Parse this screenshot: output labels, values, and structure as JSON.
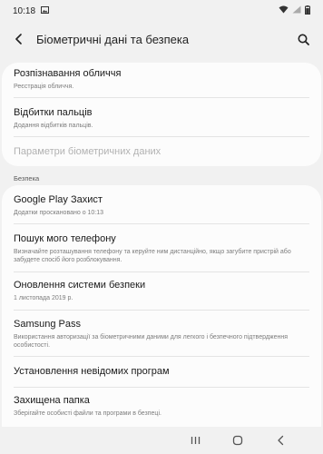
{
  "status_bar": {
    "time": "10:18"
  },
  "app_bar": {
    "title": "Біометричні дані та безпека"
  },
  "biometrics": [
    {
      "title": "Розпізнавання обличчя",
      "subtitle": "Реєстрація обличчя."
    },
    {
      "title": "Відбитки пальців",
      "subtitle": "Додання відбитків пальців."
    },
    {
      "title": "Параметри біометричних даних",
      "disabled": true
    }
  ],
  "security_header": "Безпека",
  "security": [
    {
      "title": "Google Play Захист",
      "subtitle": "Додатки проскановано о 10:13"
    },
    {
      "title": "Пошук мого телефону",
      "subtitle": "Визначайте розташування телефону та керуйте ним дистанційно, якщо загубите пристрій або забудете спосіб його розблокування."
    },
    {
      "title": "Оновлення системи безпеки",
      "subtitle": "1 листопада 2019 р."
    },
    {
      "title": "Samsung Pass",
      "subtitle": "Використання авторизації за біометричними даними для легкого і безпечного підтвердження особистості."
    },
    {
      "title": "Установлення невідомих програм"
    },
    {
      "title": "Захищена папка",
      "subtitle": "Зберігайте особисті файли та програми в безпеці."
    }
  ],
  "icons": {
    "image": "image-notification-icon",
    "wifi": "wifi-icon",
    "signal": "signal-icon",
    "battery": "battery-icon",
    "back": "back-arrow-icon",
    "search": "search-icon",
    "recents": "recents-icon",
    "home": "home-icon",
    "nav_back": "nav-back-icon"
  }
}
